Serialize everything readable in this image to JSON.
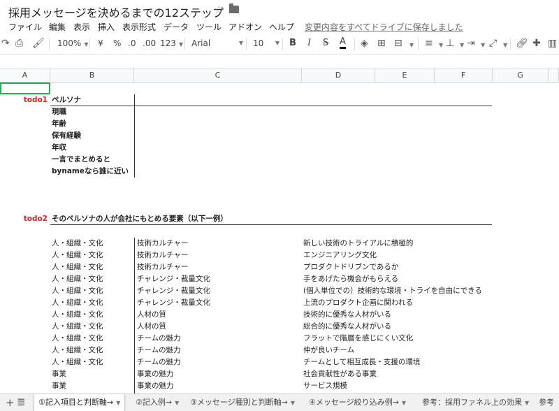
{
  "title": "採用メッセージを決めるまでの12ステップ",
  "menu": [
    "ファイル",
    "編集",
    "表示",
    "挿入",
    "表示形式",
    "データ",
    "ツール",
    "アドオン",
    "ヘルプ"
  ],
  "save_status": "変更内容をすべてドライブに保存しました",
  "toolbar": {
    "zoom": "100%",
    "currency": "¥",
    "percent": "%",
    "dec_less": ".0",
    "dec_more": ".00",
    "more_formats": "123",
    "font": "Arial",
    "font_size": "10",
    "bold": "B",
    "italic": "I",
    "strike": "S",
    "text_color": "A",
    "text_color_hex": "#000000"
  },
  "columns": [
    "A",
    "B",
    "C",
    "D",
    "E",
    "F",
    "G"
  ],
  "todo1": {
    "tag": "todo1",
    "heading": "ペルソナ",
    "items": [
      "現職",
      "年齢",
      "保有経験",
      "年収",
      "一言でまとめると",
      "bynameなら誰に近い"
    ]
  },
  "todo2": {
    "tag": "todo2",
    "heading": "そのペルソナの人が会社にもとめる要素（以下一例）",
    "rows": [
      {
        "b": "人・組織・文化",
        "c": "技術カルチャー",
        "d": "新しい技術のトライアルに積極的"
      },
      {
        "b": "人・組織・文化",
        "c": "技術カルチャー",
        "d": "エンジニアリング文化"
      },
      {
        "b": "人・組織・文化",
        "c": "技術カルチャー",
        "d": "プロダクトドリブンであるか"
      },
      {
        "b": "人・組織・文化",
        "c": "チャレンジ・裁量文化",
        "d": "手をあげたら機会がもらえる"
      },
      {
        "b": "人・組織・文化",
        "c": "チャレンジ・裁量文化",
        "d": "(個人単位での）技術的な環境・トライを自由にできる"
      },
      {
        "b": "人・組織・文化",
        "c": "チャレンジ・裁量文化",
        "d": "上流のプロダクト企画に関われる"
      },
      {
        "b": "人・組織・文化",
        "c": "人材の質",
        "d": "技術的に優秀な人材がいる"
      },
      {
        "b": "人・組織・文化",
        "c": "人材の質",
        "d": "総合的に優秀な人材がいる"
      },
      {
        "b": "人・組織・文化",
        "c": "チームの魅力",
        "d": "フラットで階層を感じにくい文化"
      },
      {
        "b": "人・組織・文化",
        "c": "チームの魅力",
        "d": "仲が良いチーム"
      },
      {
        "b": "人・組織・文化",
        "c": "チームの魅力",
        "d": "チームとして相互成長・支援の環境"
      },
      {
        "b": "事業",
        "c": "事業の魅力",
        "d": "社会貢献性がある事業"
      },
      {
        "b": "事業",
        "c": "事業の魅力",
        "d": "サービス規模"
      }
    ]
  },
  "tabs": [
    "①記入項目と判断軸→",
    "②記入例→",
    "③メッセージ種別と判断軸→",
    "④メッセージ絞り込み例→",
    "参考：採用ファネル上の効果",
    "参考"
  ],
  "colors": {
    "todo": "#e02020",
    "selection": "#34a853"
  }
}
